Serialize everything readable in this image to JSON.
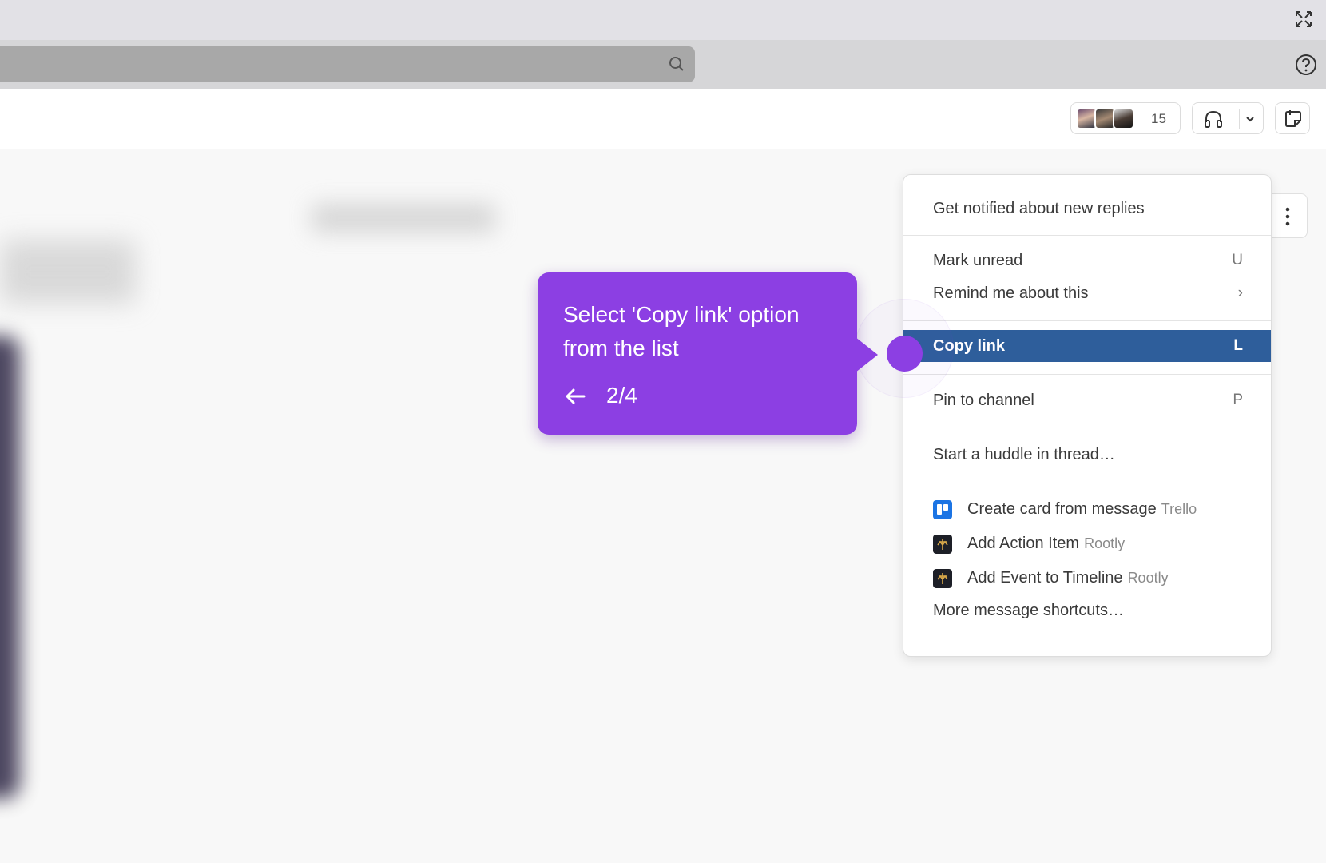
{
  "header": {
    "member_count": "15"
  },
  "menu": {
    "items": [
      {
        "label": "Get notified about new replies",
        "shortcut": ""
      },
      {
        "label": "Mark unread",
        "shortcut": "U"
      },
      {
        "label": "Remind me about this",
        "shortcut": "›"
      },
      {
        "label": "Copy link",
        "shortcut": "L"
      },
      {
        "label": "Pin to channel",
        "shortcut": "P"
      },
      {
        "label": "Start a huddle in thread…",
        "shortcut": ""
      }
    ],
    "apps": [
      {
        "label": "Create card from message",
        "app": "Trello",
        "icon": "trello-icon"
      },
      {
        "label": "Add Action Item",
        "app": "Rootly",
        "icon": "rootly-icon"
      },
      {
        "label": "Add Event to Timeline",
        "app": "Rootly",
        "icon": "rootly-icon"
      }
    ],
    "more": "More message shortcuts…",
    "highlight_color": "#2e5e9b"
  },
  "tooltip": {
    "text": "Select 'Copy link' option from the list",
    "step": "2/4",
    "color": "#8c3fe3"
  }
}
